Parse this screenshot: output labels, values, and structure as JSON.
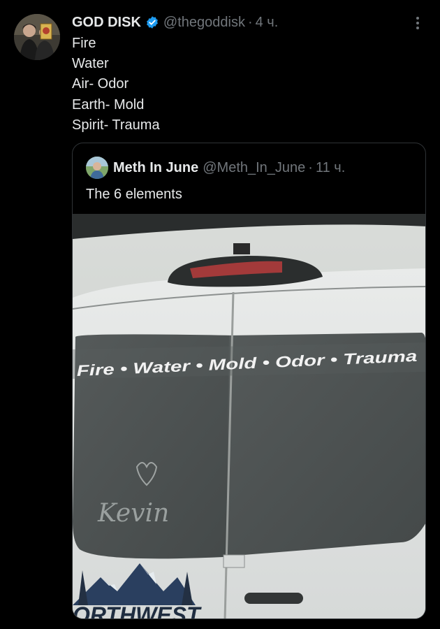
{
  "tweet": {
    "author_name": "GOD DISK",
    "handle": "@thegoddisk",
    "separator": "·",
    "time": "4 ч.",
    "lines": [
      "Fire",
      "Water",
      "Air- Odor",
      "Earth- Mold",
      "Spirit- Trauma"
    ]
  },
  "quoted": {
    "author_name": "Meth In June",
    "handle": "@Meth_In_June",
    "separator": "·",
    "time": "11 ч.",
    "text": "The 6 elements",
    "image": {
      "window_text": "Fire • Water • Mold • Odor • Trauma",
      "handwriting": "Kevin",
      "logo_text": "ORTHWEST"
    }
  },
  "icons": {
    "verified": "verified-badge-icon",
    "more": "more-options-icon"
  },
  "colors": {
    "background": "#000000",
    "text_primary": "#e7e9ea",
    "text_secondary": "#71767b",
    "verified_blue": "#1d9bf0",
    "border": "#2f3336"
  }
}
